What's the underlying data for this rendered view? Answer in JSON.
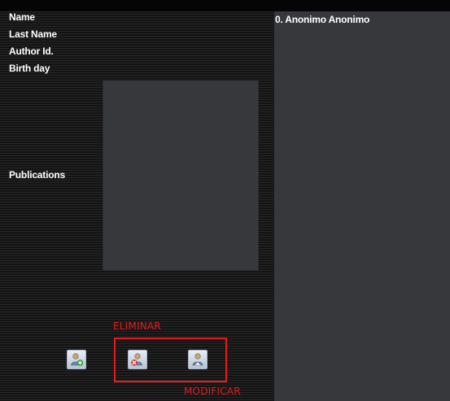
{
  "form": {
    "name_label": "Name",
    "last_name_label": "Last Name",
    "author_id_label": "Author Id.",
    "birth_day_label": "Birth day",
    "publications_label": "Publications"
  },
  "authors_list": {
    "items": [
      "0. Anonimo Anonimo"
    ]
  },
  "toolbar": {
    "add_icon": "add-user-icon",
    "delete_icon": "delete-user-icon",
    "edit_icon": "edit-user-icon"
  },
  "annotations": {
    "eliminar": "ELIMINAR",
    "modificar": "MODIFICAR",
    "color": "#e8191b"
  }
}
